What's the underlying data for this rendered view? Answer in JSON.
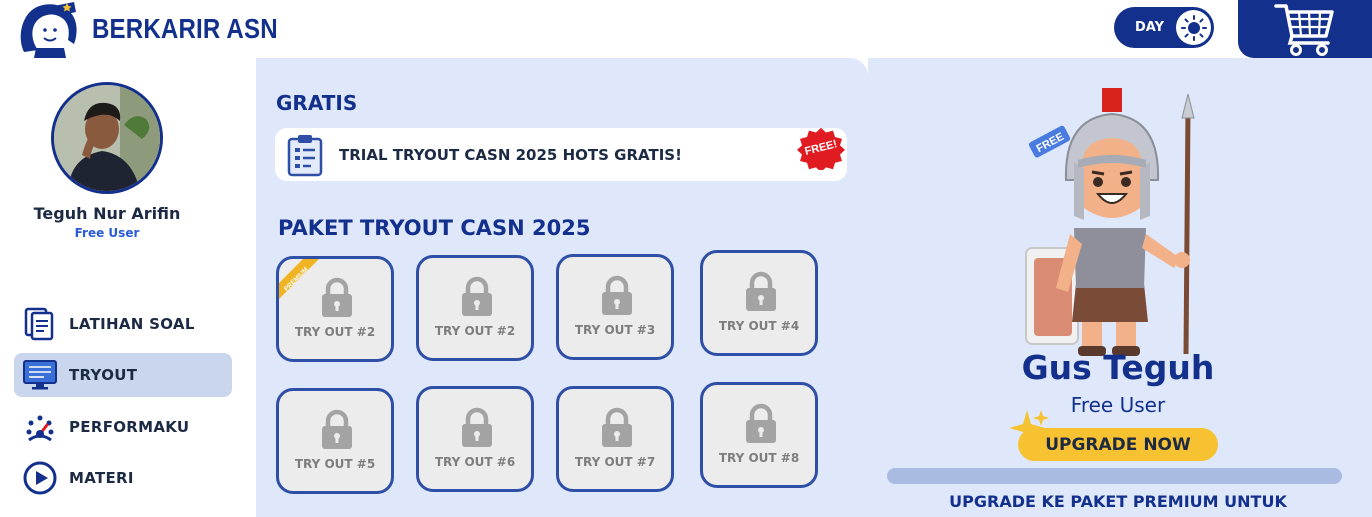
{
  "header": {
    "brand_name": "BERKARIR ASN",
    "theme_toggle_label": "DAY",
    "cart_icon": "cart-icon"
  },
  "sidebar": {
    "user_name": "Teguh Nur Arifin",
    "user_status": "Free User",
    "nav_items": [
      {
        "label": "LATIHAN SOAL",
        "icon": "document-icon",
        "active": false
      },
      {
        "label": "TRYOUT",
        "icon": "monitor-icon",
        "active": true
      },
      {
        "label": "PERFORMAKU",
        "icon": "gauge-icon",
        "active": false
      },
      {
        "label": "MATERI",
        "icon": "play-icon",
        "active": false
      }
    ]
  },
  "main": {
    "gratis_title": "GRATIS",
    "trial_label": "TRIAL TRYOUT CASN 2025 HOTS GRATIS!",
    "trial_badge": "FREE!",
    "paket_title": "PAKET TRYOUT CASN 2025",
    "tiles": [
      {
        "label": "TRY OUT #2",
        "ribbon": "PREMIUM"
      },
      {
        "label": "TRY OUT #2"
      },
      {
        "label": "TRY OUT #3"
      },
      {
        "label": "TRY OUT #4"
      },
      {
        "label": "TRY OUT #5"
      },
      {
        "label": "TRY OUT #6"
      },
      {
        "label": "TRY OUT #7"
      },
      {
        "label": "TRY OUT #8"
      }
    ]
  },
  "promo": {
    "mascot_badge": "FREE",
    "name": "Gus Teguh",
    "status": "Free User",
    "upgrade_label": "UPGRADE NOW",
    "footer_text": "UPGRADE KE PAKET PREMIUM UNTUK"
  },
  "colors": {
    "brand": "#12308c",
    "panel": "#dfe8fa",
    "accent": "#f6c232",
    "free_badge": "#e11b22"
  }
}
